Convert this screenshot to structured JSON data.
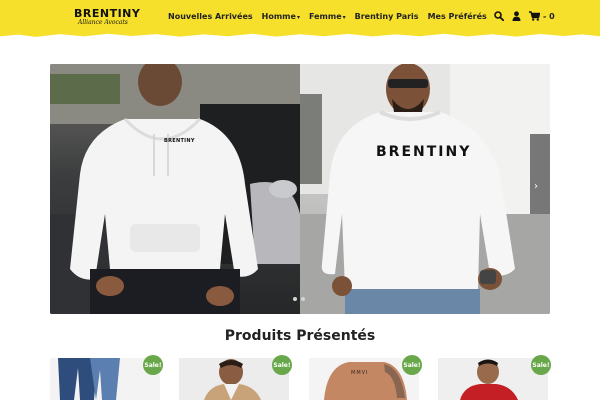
{
  "brand": {
    "name": "BRENTINY",
    "tagline": "Alliance Avocats"
  },
  "nav": {
    "items": [
      {
        "label": "Nouvelles Arrivées",
        "dropdown": false
      },
      {
        "label": "Homme",
        "dropdown": true
      },
      {
        "label": "Femme",
        "dropdown": true
      },
      {
        "label": "Brentiny Paris",
        "dropdown": false
      },
      {
        "label": "Mes Préférés",
        "dropdown": false
      }
    ]
  },
  "header_icons": {
    "search": "search-icon",
    "account": "user-icon",
    "cart": "cart-icon",
    "cart_count": "- 0"
  },
  "carousel": {
    "slides": [
      {
        "print": "BRENTINY",
        "product": "hoodie"
      },
      {
        "print": "BRENTINY",
        "product": "sweatshirt"
      }
    ],
    "next_icon": "chevron-right-icon",
    "active_index": 0,
    "slide_count": 2
  },
  "featured": {
    "title": "Produits Présentés",
    "products": [
      {
        "badge": "Sale!"
      },
      {
        "badge": "Sale!"
      },
      {
        "badge": "Sale!"
      },
      {
        "badge": "Sale!"
      }
    ]
  },
  "colors": {
    "header": "#f7e02b",
    "badge": "#68a84a",
    "text": "#222222"
  }
}
